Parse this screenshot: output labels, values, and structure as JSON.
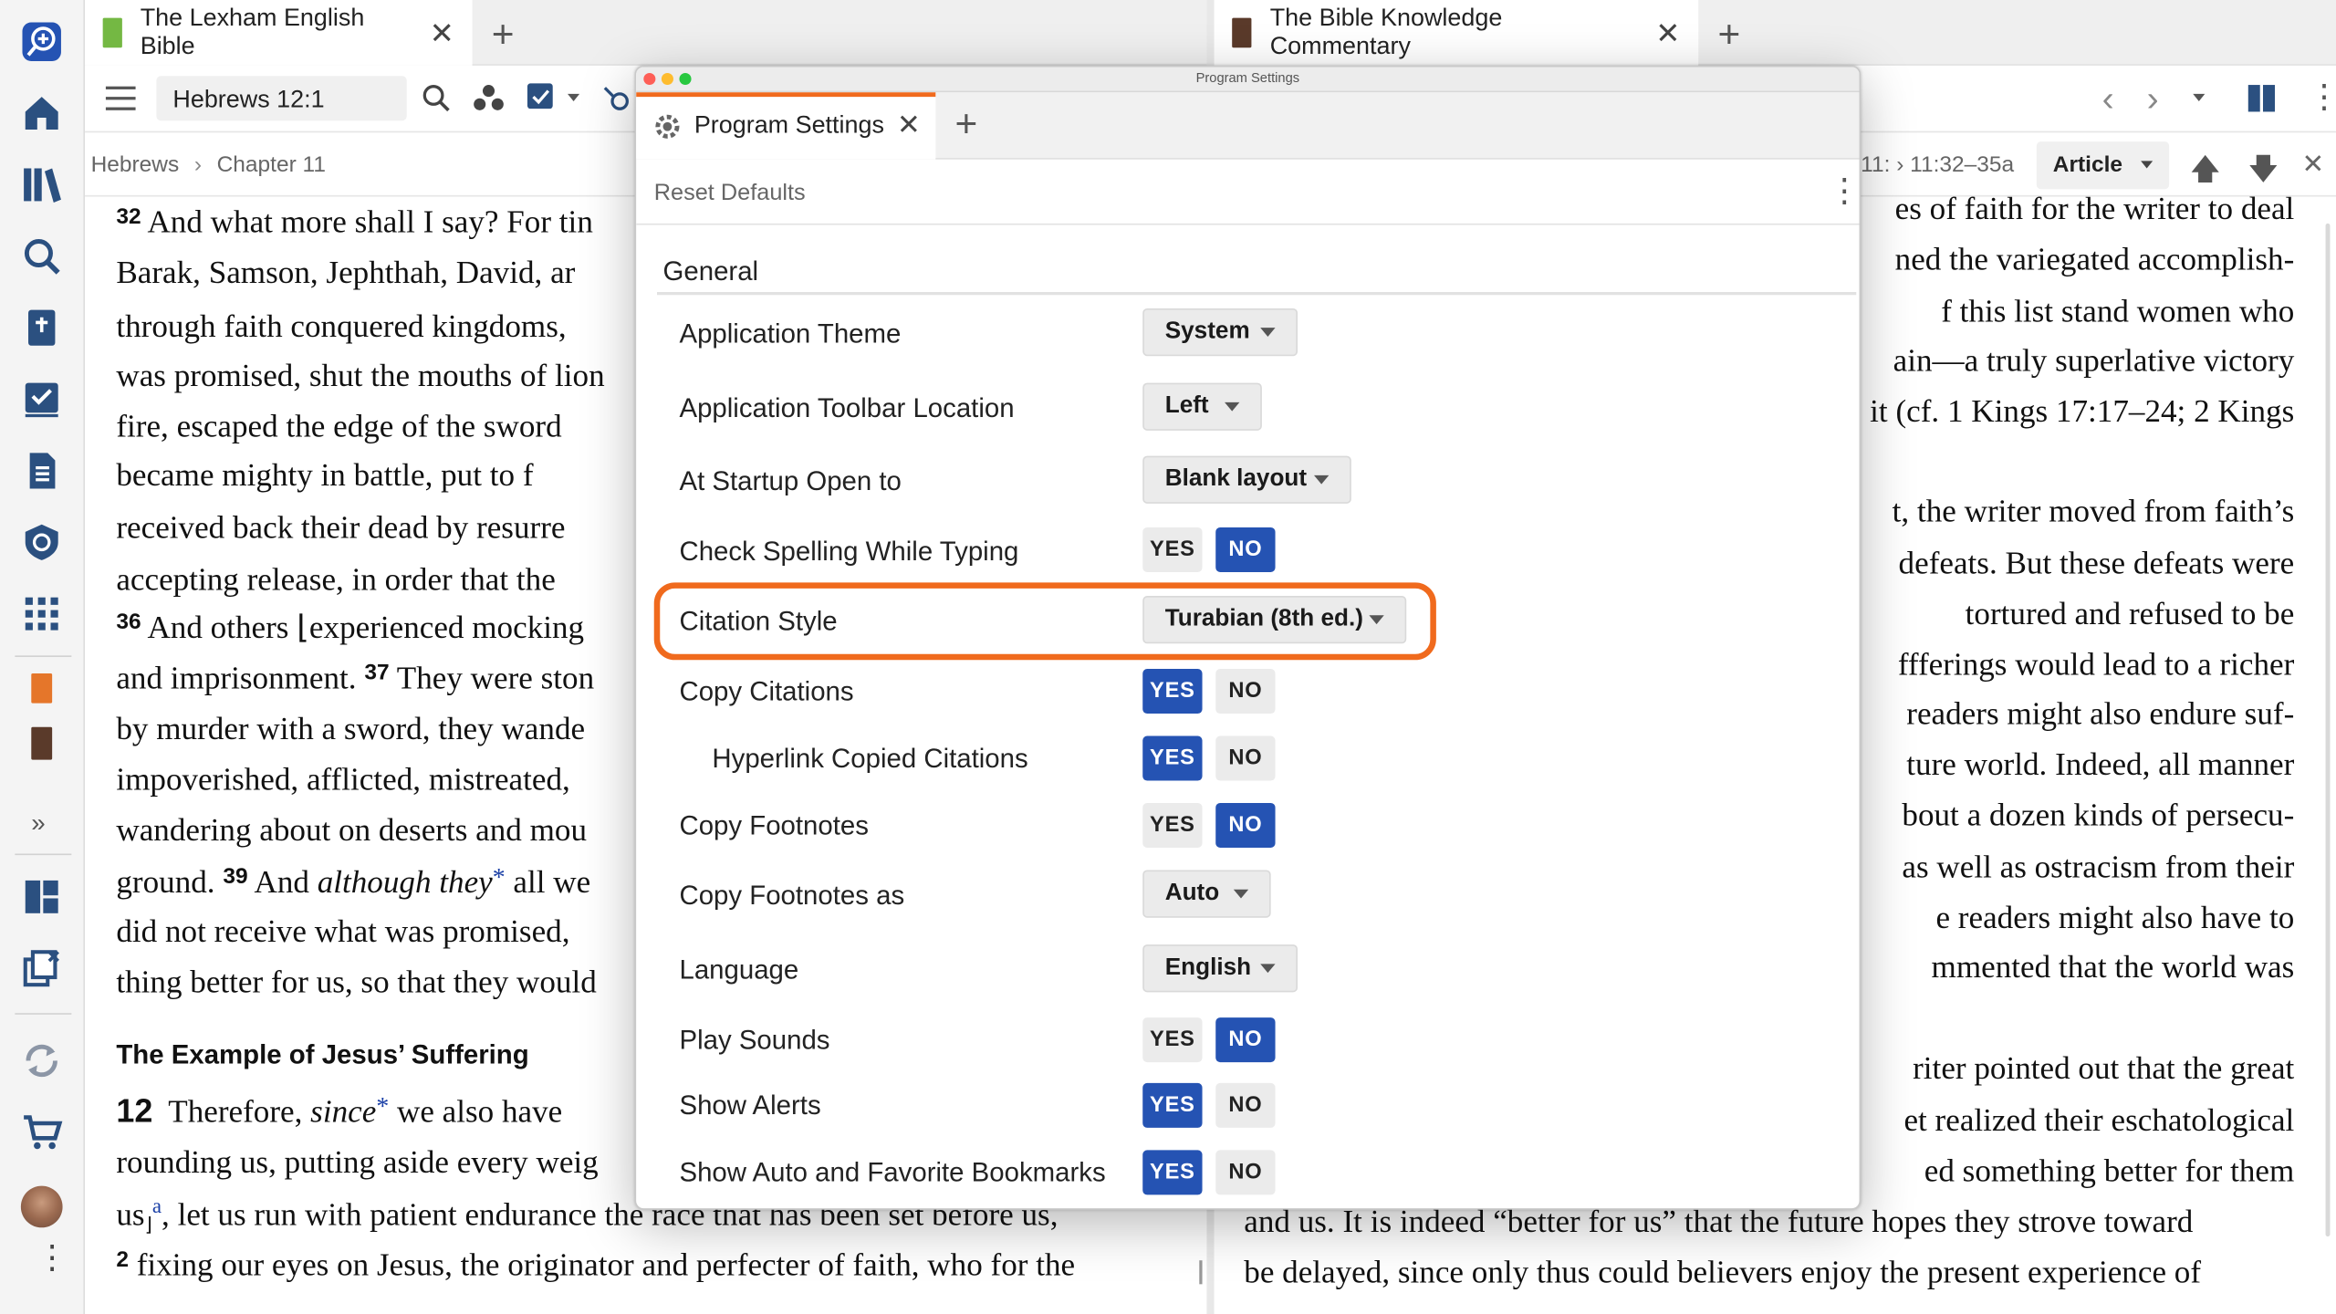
{
  "left_panel": {
    "tab_title": "The Lexham English Bible",
    "reference": "Hebrews 12:1",
    "breadcrumb_book": "Hebrews",
    "breadcrumb_chapter": "Chapter 11",
    "lines": [
      {
        "vn": "32",
        "text": "And what more shall I say? For tin"
      },
      {
        "text": "Barak, Samson, Jephthah, David, ar"
      },
      {
        "text": "through faith conquered kingdoms,"
      },
      {
        "text": "was promised, shut the mouths of lion"
      },
      {
        "text": "fire, escaped the edge of the sword"
      },
      {
        "text": "became mighty in battle, put to f"
      },
      {
        "text": "received back their dead by resurre"
      },
      {
        "text": "accepting release, in order that the"
      },
      {
        "vn": "36",
        "text": "And others ⌊experienced mocking"
      },
      {
        "text": "and imprisonment.",
        "vn2": "37",
        "text2": "They were ston"
      },
      {
        "text": "by murder with a sword, they wande"
      },
      {
        "text": "impoverished, afflicted, mistreated,"
      },
      {
        "text": "wandering about on deserts and mou"
      },
      {
        "text": "ground.",
        "vn2": "39",
        "text2": "And",
        "italic": "although they",
        "mark": "*",
        "text3": "all we"
      },
      {
        "text": "did not receive what was promised,"
      },
      {
        "text": "thing better for us, so that they would"
      }
    ],
    "heading": "The Example of Jesus’ Suffering",
    "chapter_num": "12",
    "ch12_line1a": "Therefore,",
    "ch12_line1_italic": "since",
    "ch12_line1_mark": "*",
    "ch12_line1b": "we also have",
    "ch12_line2": "rounding us, putting aside every weig",
    "ch12_line3a": "us",
    "ch12_line3_sup": "a",
    "ch12_line3b": ", let us run with patient endurance the race that has been set before us,",
    "ch12_v2": "2",
    "ch12_line4": "fixing our eyes on Jesus, the originator and perfecter of faith, who for the"
  },
  "right_panel": {
    "tab_title": "The Bible Knowledge Commentary",
    "ref_range": "11:32–35a",
    "ref_prefix": "11: ›",
    "article_label": "Article",
    "lines": [
      "es of faith for the writer to deal",
      "ned the variegated accomplish-",
      "f this list stand women who",
      "ain—a truly superlative victory",
      "it (cf. 1 Kings 17:17–24; 2 Kings",
      "t, the writer moved from faith’s",
      "defeats. But these defeats were",
      "tortured and refused to be",
      "ffferings would lead to a richer",
      "readers might also endure suf-",
      "ture world. Indeed, all manner",
      "bout a dozen kinds of persecu-",
      "as well as ostracism from their",
      "e readers might also have to",
      "mmented that the world was",
      "riter pointed out that the great",
      "et realized their eschatological",
      "ed something better for them"
    ],
    "line_a": "and us. It is indeed “better for us” that the future hopes they strove toward",
    "line_b": "be delayed, since only thus could believers enjoy the present experience of"
  },
  "dialog": {
    "window_title": "Program Settings",
    "tab_label": "Program Settings",
    "reset_label": "Reset Defaults",
    "section": "General",
    "yes": "YES",
    "no": "NO",
    "settings": {
      "theme": {
        "label": "Application Theme",
        "value": "System"
      },
      "toolbar_loc": {
        "label": "Application Toolbar Location",
        "value": "Left"
      },
      "startup": {
        "label": "At Startup Open to",
        "value": "Blank layout"
      },
      "spelling": {
        "label": "Check Spelling While Typing",
        "value": "NO"
      },
      "citation": {
        "label": "Citation Style",
        "value": "Turabian (8th ed.)"
      },
      "copy_citations": {
        "label": "Copy Citations",
        "value": "YES"
      },
      "hyperlink": {
        "label": "Hyperlink Copied Citations",
        "value": "YES"
      },
      "copy_footnotes": {
        "label": "Copy Footnotes",
        "value": "NO"
      },
      "footnotes_as": {
        "label": "Copy Footnotes as",
        "value": "Auto"
      },
      "language": {
        "label": "Language",
        "value": "English"
      },
      "sounds": {
        "label": "Play Sounds",
        "value": "NO"
      },
      "alerts": {
        "label": "Show Alerts",
        "value": "YES"
      },
      "bookmarks": {
        "label": "Show Auto and Favorite Bookmarks",
        "value": "YES"
      }
    }
  },
  "colors": {
    "accent": "#2553b3",
    "highlight": "#f06a1d",
    "link": "#1a3fa6"
  }
}
